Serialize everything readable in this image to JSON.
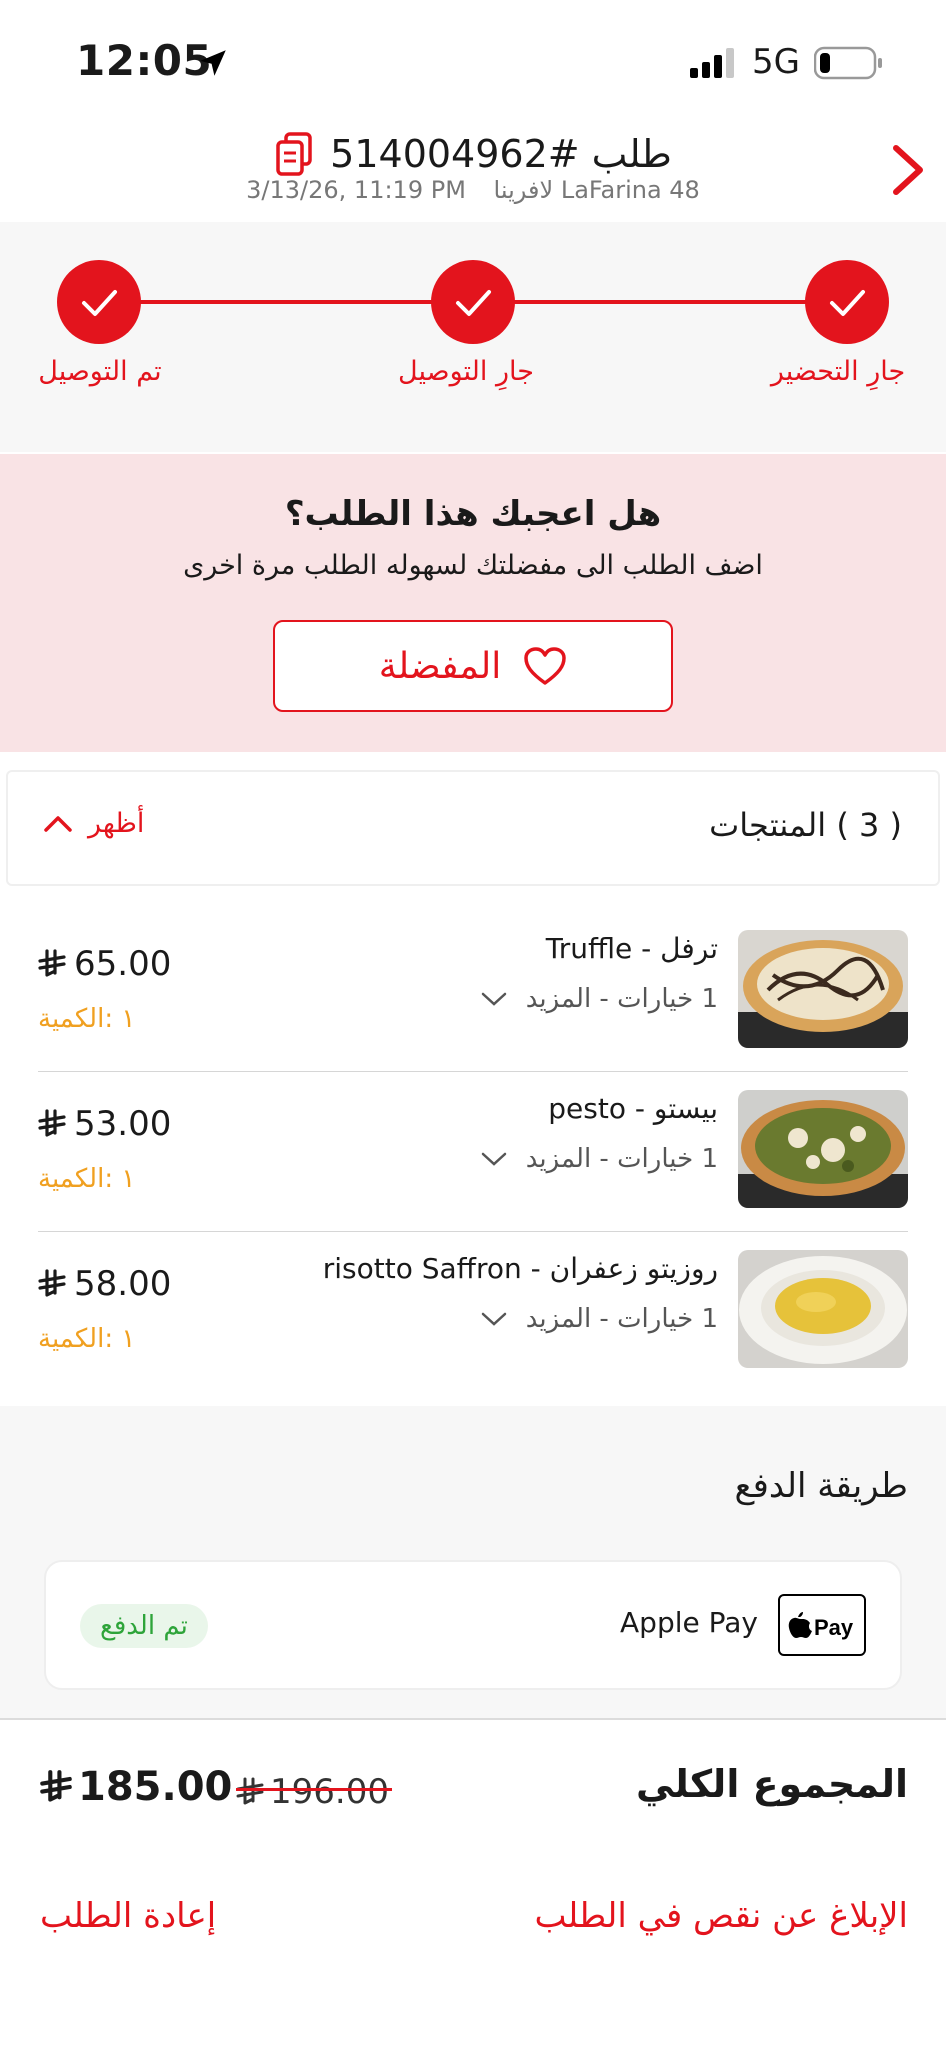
{
  "status_bar": {
    "time": "12:05",
    "network": "5G"
  },
  "header": {
    "title": "طلب #514004962",
    "date": "3/13/26, 11:19 PM",
    "store": "لافرينا LaFarina 48"
  },
  "progress": {
    "steps": [
      {
        "label": "جارِ التحضير",
        "state": "done"
      },
      {
        "label": "جارِ التوصيل",
        "state": "done"
      },
      {
        "label": "تم التوصيل",
        "state": "done"
      }
    ]
  },
  "favorite": {
    "title": "هل اعجبك هذا الطلب؟",
    "subtitle": "اضف الطلب الى مفضلتك لسهوله الطلب مرة اخرى",
    "button_label": "المفضلة"
  },
  "products": {
    "title": "( 3 ) المنتجات",
    "toggle_label": "أظهر",
    "items": [
      {
        "name": "ترفل - Truffle",
        "options": "1 خيارات - المزيد",
        "price": "65.00",
        "qty": "١ :الكمية"
      },
      {
        "name": "بيستو  - pesto",
        "options": "1 خيارات - المزيد",
        "price": "53.00",
        "qty": "١ :الكمية"
      },
      {
        "name": "روزيتو زعفران - risotto Saffron",
        "options": "1 خيارات - المزيد",
        "price": "58.00",
        "qty": "١ :الكمية"
      }
    ]
  },
  "payment": {
    "title": "طريقة الدفع",
    "method": "Apple Pay",
    "status": "تم الدفع"
  },
  "totals": {
    "label": "المجموع الكلي",
    "total": "185.00",
    "original": "196.00"
  },
  "actions": {
    "report": "الإبلاغ عن نقص في الطلب",
    "reorder": "إعادة الطلب"
  },
  "colors": {
    "accent": "#e3141d",
    "promo_bg": "#f9e3e5",
    "qty": "#f0a020",
    "paid": "#2ea43a"
  }
}
